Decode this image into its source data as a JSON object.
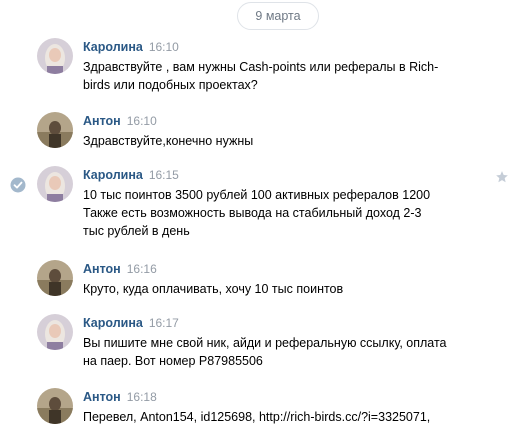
{
  "date_separator": "9 марта",
  "messages": [
    {
      "author": "Каролина",
      "time": "16:10",
      "text": "Здравствуйте , вам нужны Cash-points или рефералы в Rich-\nbirds или подобных проектах?"
    },
    {
      "author": "Антон",
      "time": "16:10",
      "text": "Здравствуйте,конечно нужны"
    },
    {
      "author": "Каролина",
      "time": "16:15",
      "text": "10 тыс поинтов 3500 рублей 100 активных рефералов 1200\nТакже есть возможность вывода на стабильный доход 2-3\nтыс рублей в день"
    },
    {
      "author": "Антон",
      "time": "16:16",
      "text": "Круто, куда оплачивать, хочу 10 тыс поинтов"
    },
    {
      "author": "Каролина",
      "time": "16:17",
      "text": "Вы пишите мне свой ник, айди и реферальную ссылку, оплата\nна паер. Вот номер P87985506"
    },
    {
      "author": "Антон",
      "time": "16:18",
      "text": "Перевел, Anton154, id125698, http://rich-birds.cc/?i=3325071,"
    }
  ],
  "colors": {
    "author": "#2a5885",
    "time": "#939ba5",
    "check": "#a3b8cc",
    "star": "#c5cdd7"
  }
}
